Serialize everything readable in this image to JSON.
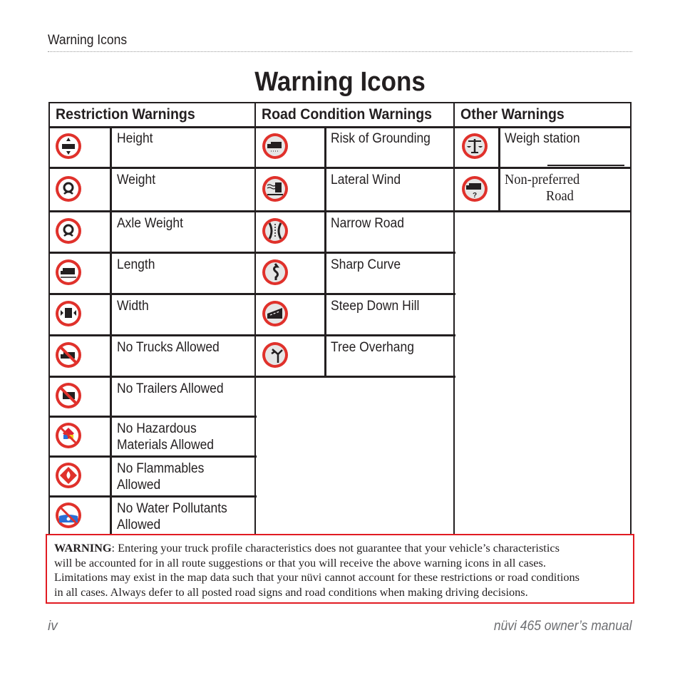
{
  "running_head": "Warning Icons",
  "page_title": "Warning Icons",
  "columns": {
    "restriction": "Restriction Warnings",
    "road": "Road Condition Warnings",
    "other": "Other Warnings"
  },
  "restriction_items": [
    {
      "label": "Height",
      "icon": "height-restriction-icon"
    },
    {
      "label": "Weight",
      "icon": "weight-restriction-icon"
    },
    {
      "label": "Axle Weight",
      "icon": "axle-weight-restriction-icon"
    },
    {
      "label": "Length",
      "icon": "length-restriction-icon"
    },
    {
      "label": "Width",
      "icon": "width-restriction-icon"
    },
    {
      "label": "No Trucks Allowed",
      "icon": "no-trucks-icon"
    },
    {
      "label": "No Trailers Allowed",
      "icon": "no-trailers-icon"
    },
    {
      "label": "No Hazardous",
      "label2": "Materials Allowed",
      "icon": "no-hazmat-icon"
    },
    {
      "label": "No Flammables",
      "label2": "Allowed",
      "icon": "no-flammables-icon"
    },
    {
      "label": "No Water Pollutants",
      "label2": "Allowed",
      "icon": "no-water-pollutants-icon"
    }
  ],
  "road_items": [
    {
      "label": "Risk of Grounding",
      "icon": "risk-of-grounding-icon"
    },
    {
      "label": "Lateral Wind",
      "icon": "lateral-wind-icon"
    },
    {
      "label": "Narrow Road",
      "icon": "narrow-road-icon"
    },
    {
      "label": "Sharp Curve",
      "icon": "sharp-curve-icon"
    },
    {
      "label": "Steep Down Hill",
      "icon": "steep-down-hill-icon"
    },
    {
      "label": "Tree Overhang",
      "icon": "tree-overhang-icon"
    }
  ],
  "other_items": [
    {
      "label": "Weigh station",
      "icon": "weigh-station-icon"
    },
    {
      "label": "Non-preferred",
      "label2": "Road",
      "icon": "non-preferred-road-icon"
    }
  ],
  "warning": {
    "bold": "WARNING",
    "line1": ": Entering your truck profile characteristics does not guarantee that your vehicle’s characteristics",
    "line2": "will be accounted for in all route suggestions or that you will receive the above warning icons in all cases.",
    "line3": "Limitations may exist in the map data such that your nüvi cannot account for these restrictions or road conditions",
    "line4": "in all cases. Always defer to all posted road signs and road conditions when making driving decisions."
  },
  "footer": {
    "page_number": "iv",
    "manual_title": "nüvi 465 owner’s manual"
  },
  "colors": {
    "sign_red": "#e0312b",
    "warning_border": "#e11b22"
  }
}
